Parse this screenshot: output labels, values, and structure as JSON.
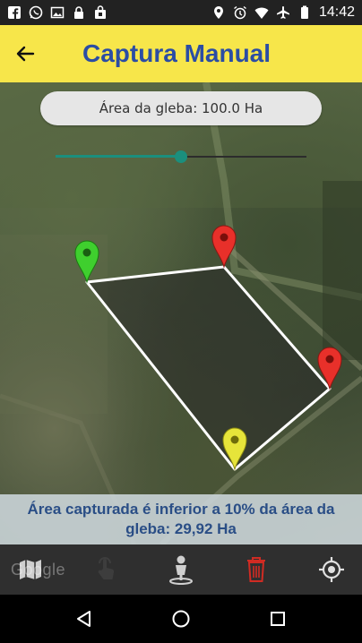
{
  "status_bar": {
    "time": "14:42",
    "icons_left": [
      "facebook-icon",
      "whatsapp-icon",
      "image-icon",
      "lock-icon",
      "bag-icon"
    ],
    "icons_right": [
      "location-icon",
      "alarm-icon",
      "wifi-icon",
      "airplane-icon",
      "battery-icon"
    ]
  },
  "app_bar": {
    "title": "Captura Manual",
    "background": "#f7e64a",
    "title_color": "#2b4da4"
  },
  "map": {
    "area_label": "Área da gleba: 100.0 Ha",
    "slider": {
      "value": 0.5,
      "color": "#1b8f7d"
    },
    "markers": [
      {
        "name": "green-marker",
        "color": "#3fcf2e"
      },
      {
        "name": "red-marker-top",
        "color": "#e8302a"
      },
      {
        "name": "red-marker-right",
        "color": "#e8302a"
      },
      {
        "name": "yellow-marker",
        "color": "#e6e43a"
      }
    ],
    "polygon_stroke": "#ffffff"
  },
  "warning": {
    "text": "Área capturada é inferior a 10% da área da gleba: 29,92 Ha",
    "color": "#2a4e86"
  },
  "map_attribution": "Google",
  "toolbar": {
    "items": [
      {
        "name": "map-layers-button",
        "icon": "map-icon"
      },
      {
        "name": "touch-capture-button",
        "icon": "touch-icon"
      },
      {
        "name": "walk-capture-button",
        "icon": "person-pin-icon"
      },
      {
        "name": "delete-button",
        "icon": "trash-icon",
        "color": "#d02b23"
      },
      {
        "name": "my-location-button",
        "icon": "crosshair-icon"
      }
    ]
  },
  "nav_bar": {
    "items": [
      "back-nav",
      "home-nav",
      "recents-nav"
    ]
  }
}
